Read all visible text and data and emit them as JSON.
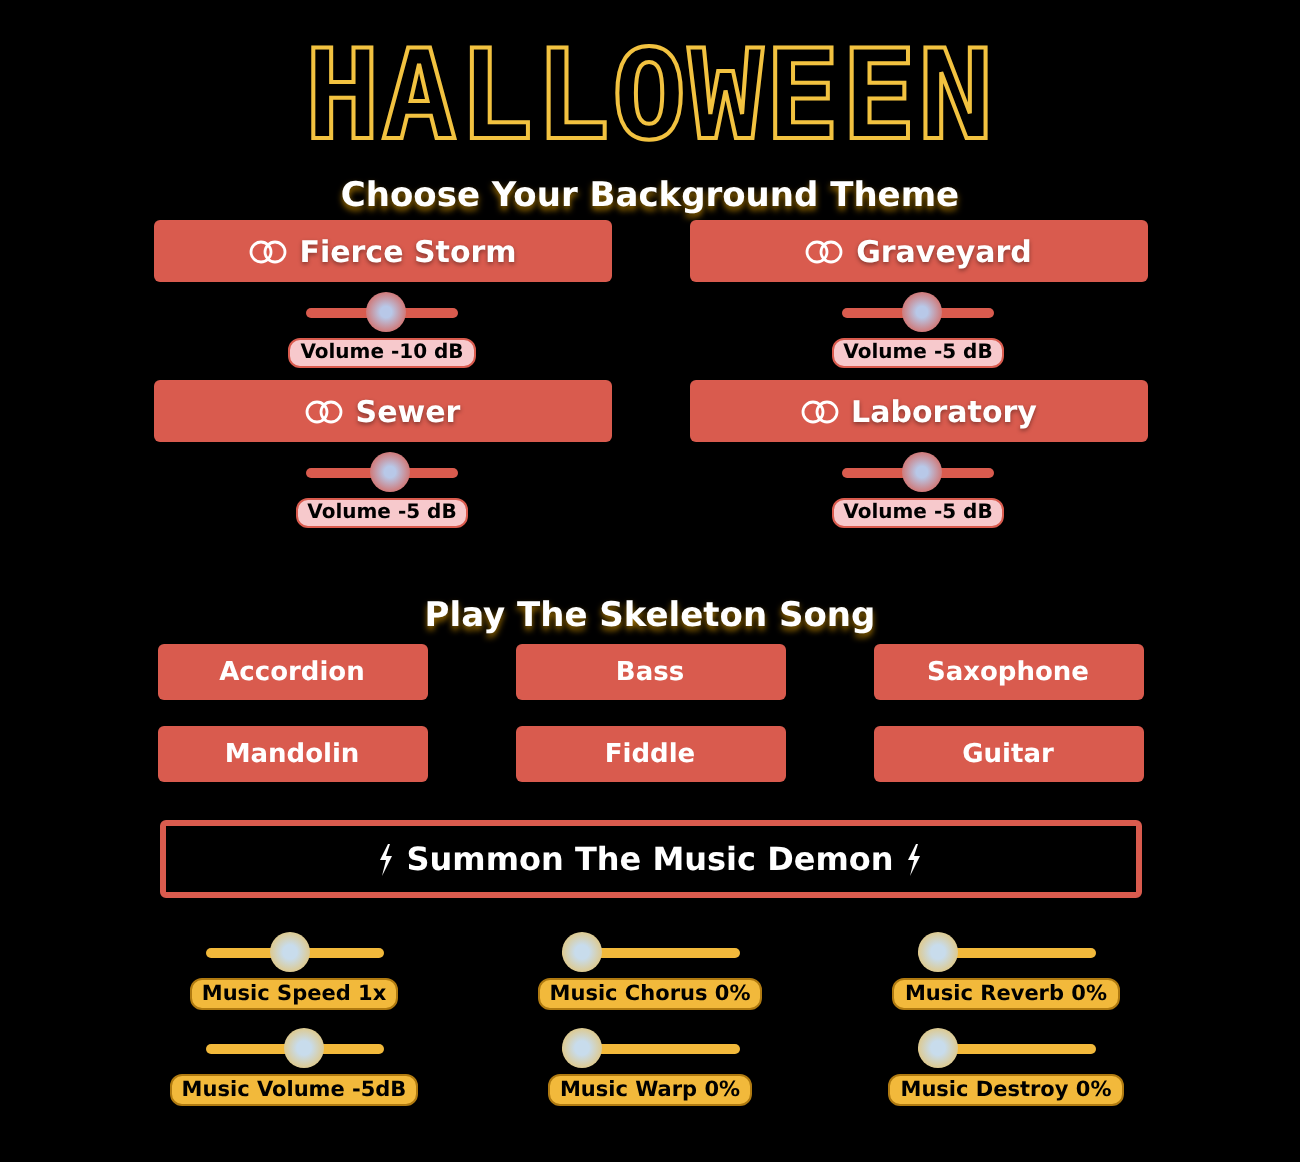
{
  "title": "HALLOWEEN",
  "themes": {
    "heading": "Choose Your Background Theme",
    "items": [
      {
        "label": "Fierce Storm",
        "level": 0.54,
        "reading": "Volume -10 dB"
      },
      {
        "label": "Graveyard",
        "level": 0.53,
        "reading": "Volume -5 dB"
      },
      {
        "label": "Sewer",
        "level": 0.58,
        "reading": "Volume -5 dB"
      },
      {
        "label": "Laboratory",
        "level": 0.53,
        "reading": "Volume -5 dB"
      }
    ]
  },
  "song": {
    "heading": "Play The Skeleton Song",
    "instruments": [
      "Accordion",
      "Bass",
      "Saxophone",
      "Mandolin",
      "Fiddle",
      "Guitar"
    ]
  },
  "summon": {
    "label": "Summon The Music Demon"
  },
  "music_controls": [
    {
      "reading": "Music Speed 1x",
      "level": 0.47
    },
    {
      "reading": "Music Chorus 0%",
      "level": 0
    },
    {
      "reading": "Music Reverb 0%",
      "level": 0
    },
    {
      "reading": "Music Volume -5dB",
      "level": 0.57
    },
    {
      "reading": "Music Warp 0%",
      "level": 0
    },
    {
      "reading": "Music Destroy 0%",
      "level": 0
    }
  ]
}
